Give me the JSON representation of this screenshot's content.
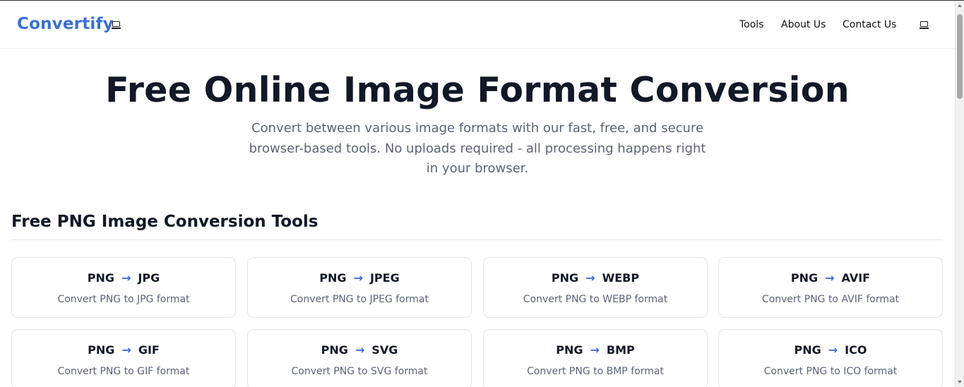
{
  "header": {
    "logo": "Convertify",
    "logo_icon": "laptop-icon",
    "nav": [
      "Tools",
      "About Us",
      "Contact Us"
    ],
    "theme_icon": "laptop-icon"
  },
  "hero": {
    "title": "Free Online Image Format Conversion",
    "subtitle": "Convert between various image formats with our fast, free, and secure browser-based tools. No uploads required - all processing happens right in your browser."
  },
  "section": {
    "title": "Free PNG Image Conversion Tools"
  },
  "tools": [
    {
      "from": "PNG",
      "to": "JPG",
      "desc": "Convert PNG to JPG format"
    },
    {
      "from": "PNG",
      "to": "JPEG",
      "desc": "Convert PNG to JPEG format"
    },
    {
      "from": "PNG",
      "to": "WEBP",
      "desc": "Convert PNG to WEBP format"
    },
    {
      "from": "PNG",
      "to": "AVIF",
      "desc": "Convert PNG to AVIF format"
    },
    {
      "from": "PNG",
      "to": "GIF",
      "desc": "Convert PNG to GIF format"
    },
    {
      "from": "PNG",
      "to": "SVG",
      "desc": "Convert PNG to SVG format"
    },
    {
      "from": "PNG",
      "to": "BMP",
      "desc": "Convert PNG to BMP format"
    },
    {
      "from": "PNG",
      "to": "ICO",
      "desc": "Convert PNG to ICO format"
    }
  ],
  "colors": {
    "accent": "#3b6fd6",
    "text": "#111827",
    "muted": "#5b6478"
  }
}
